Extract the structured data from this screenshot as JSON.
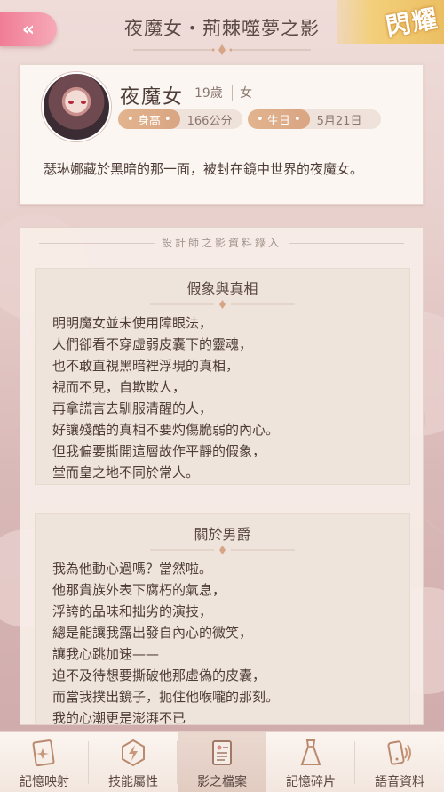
{
  "header": {
    "title": "夜魔女・荊棘噬夢之影",
    "badge": "閃耀"
  },
  "profile": {
    "name": "夜魔女",
    "age": "19歲",
    "gender": "女",
    "height_label": "身高",
    "height_value": "166公分",
    "birthday_label": "生日",
    "birthday_value": "5月21日",
    "description": "瑟琳娜藏於黑暗的那一面，被封在鏡中世界的夜魔女。"
  },
  "panel": {
    "heading": "設計師之影資料錄入",
    "sections": [
      {
        "title": "假象與真相",
        "lines": [
          "明明魔女並未使用障眼法，",
          "人們卻看不穿虛弱皮囊下的靈魂，",
          "也不敢直視黑暗裡浮現的真相，",
          "視而不見，自欺欺人，",
          "再拿謊言去馴服清醒的人，",
          "好讓殘酷的真相不要灼傷脆弱的內心。",
          "但我偏要撕開這層故作平靜的假象，",
          "堂而皇之地不同於常人。"
        ]
      },
      {
        "title": "關於男爵",
        "lines": [
          "我為他動心過嗎？當然啦。",
          "他那貴族外表下腐朽的氣息，",
          "浮誇的品味和拙劣的演技，",
          "總是能讓我露出發自內心的微笑，",
          "讓我心跳加速——",
          "迫不及待想要撕破他那虛偽的皮囊，",
          "而當我撲出鏡子，扼住他喉嚨的那刻。",
          "我的心潮更是澎湃不已"
        ]
      }
    ]
  },
  "nav": {
    "items": [
      {
        "label": "記憶映射",
        "icon": "memory-card-icon"
      },
      {
        "label": "技能屬性",
        "icon": "skill-lightning-icon"
      },
      {
        "label": "影之檔案",
        "icon": "file-document-icon"
      },
      {
        "label": "記憶碎片",
        "icon": "dress-icon"
      },
      {
        "label": "語音資料",
        "icon": "voice-phone-icon"
      }
    ],
    "active_index": 2
  },
  "colors": {
    "accent_pink": "#f07d95",
    "gold_badge": "#e9b85a",
    "pill_brown": "#d9a583"
  }
}
